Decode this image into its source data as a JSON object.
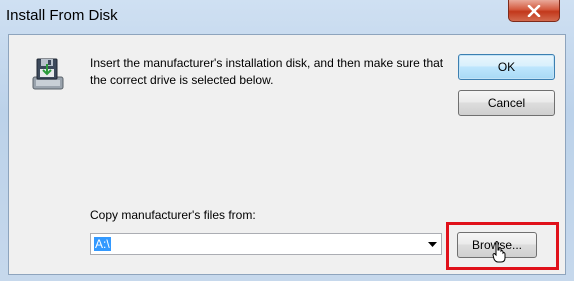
{
  "window": {
    "title": "Install From Disk"
  },
  "icons": {
    "close": "close-icon",
    "disk": "install-disk-icon",
    "dropdown": "chevron-down-icon",
    "cursor": "hand-pointer-cursor"
  },
  "dialog": {
    "instructions": "Insert the manufacturer's installation disk, and then make sure that the correct drive is selected below.",
    "ok_label": "OK",
    "cancel_label": "Cancel",
    "copy_label": "Copy manufacturer's files from:",
    "path_value": "A:\\",
    "browse_label": "Browse..."
  },
  "colors": {
    "highlight": "#e0101a",
    "selection": "#3399ff"
  }
}
